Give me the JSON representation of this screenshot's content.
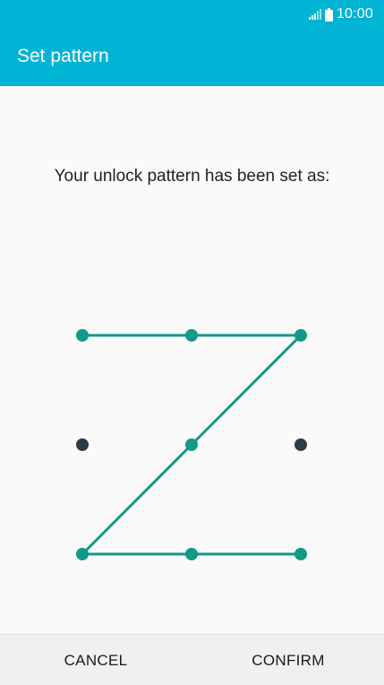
{
  "status_bar": {
    "time": "10:00",
    "signal_icon": "signal-icon",
    "battery_icon": "battery-icon"
  },
  "app_bar": {
    "title": "Set pattern",
    "color": "#00b4d6"
  },
  "main": {
    "message": "Your unlock pattern has been set as:"
  },
  "pattern": {
    "grid_size": 3,
    "sequence": [
      1,
      2,
      3,
      5,
      7,
      8,
      9
    ],
    "active_color": "#119988",
    "inactive_color": "#2b3d44",
    "line_color": "#119988"
  },
  "bottom_bar": {
    "cancel_label": "CANCEL",
    "confirm_label": "CONFIRM"
  }
}
